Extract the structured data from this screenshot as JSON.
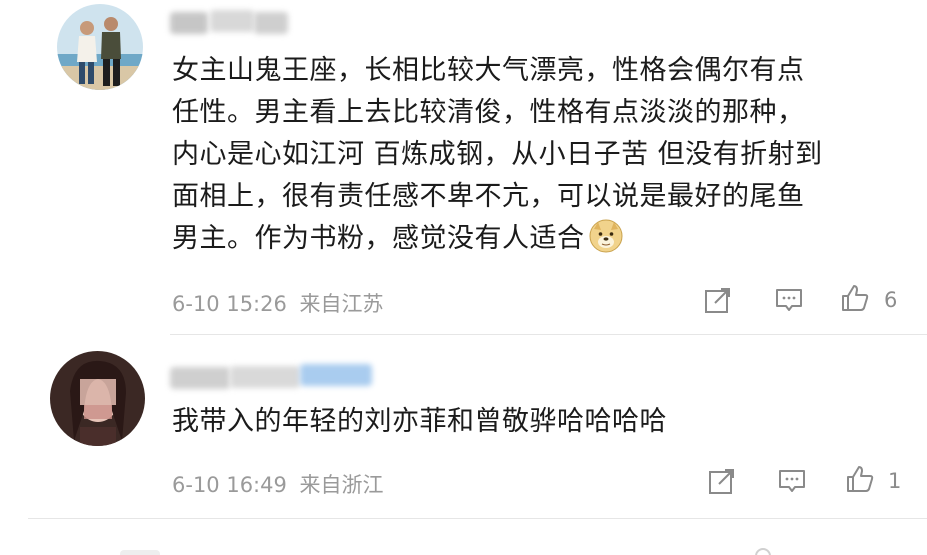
{
  "comments": [
    {
      "text_lines": [
        "女主山鬼王座，长相比较大气漂亮，性格会偶尔有点",
        "任性。男主看上去比较清俊，性格有点淡淡的那种，",
        "内心是心如江河 百炼成钢，从小日子苦 但没有折射到",
        "面相上，很有责任感不卑不亢，可以说是最好的尾鱼",
        "男主。作为书粉，感觉没有人适合"
      ],
      "emoji": "doge-emoji",
      "timestamp": "6-10 15:26",
      "location": "来自江苏",
      "like_count": "6"
    },
    {
      "text_lines": [
        "我带入的年轻的刘亦菲和曾敬骅哈哈哈哈"
      ],
      "timestamp": "6-10 16:49",
      "location": "来自浙江",
      "like_count": "1"
    }
  ],
  "icons": {
    "share": "share-icon",
    "reply": "comment-icon",
    "like": "thumbs-up-icon"
  }
}
